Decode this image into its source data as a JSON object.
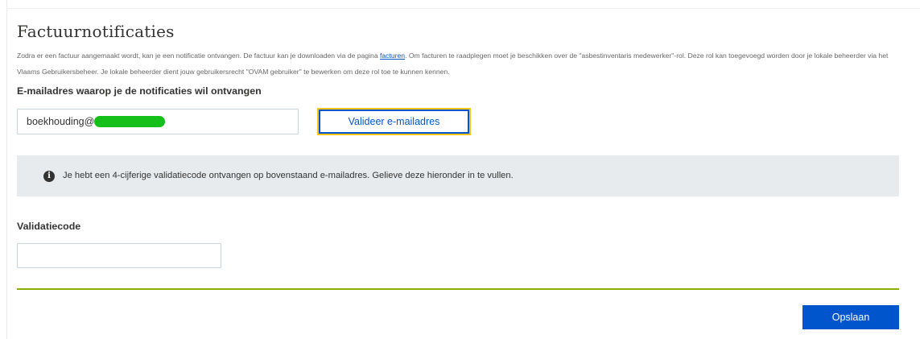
{
  "page": {
    "title": "Factuurnotificaties",
    "intro": {
      "part1": "Zodra er een factuur aangemaakt wordt, kan je een notificatie ontvangen. De factuur kan je downloaden via de pagina ",
      "link": "facturen",
      "part2": ". Om facturen te raadplegen moet je beschikken over de \"asbestinventaris medewerker\"-rol. Deze rol kan toegevoegd worden door je lokale beheerder via het Vlaams Gebruikersbeheer. Je lokale beheerder dient jouw gebruikersrecht \"OVAM gebruiker\" te bewerken om deze rol toe te kunnen kennen."
    }
  },
  "email": {
    "label": "E-mailadres waarop je de notificaties wil ontvangen",
    "value": "boekhouding@",
    "validate_button": "Valideer e-mailadres"
  },
  "info": {
    "icon": "info-icon",
    "text": "Je hebt een 4-cijferige validatiecode ontvangen op bovenstaand e-mailadres. Gelieve deze hieronder in te vullen."
  },
  "validation": {
    "label": "Validatiecode",
    "value": ""
  },
  "actions": {
    "save_button": "Opslaan"
  },
  "colors": {
    "primary": "#0055cc",
    "focus": "#ffc515",
    "divider": "#8bae00",
    "info_bg": "#e8ebee",
    "redaction": "#16c01b"
  }
}
